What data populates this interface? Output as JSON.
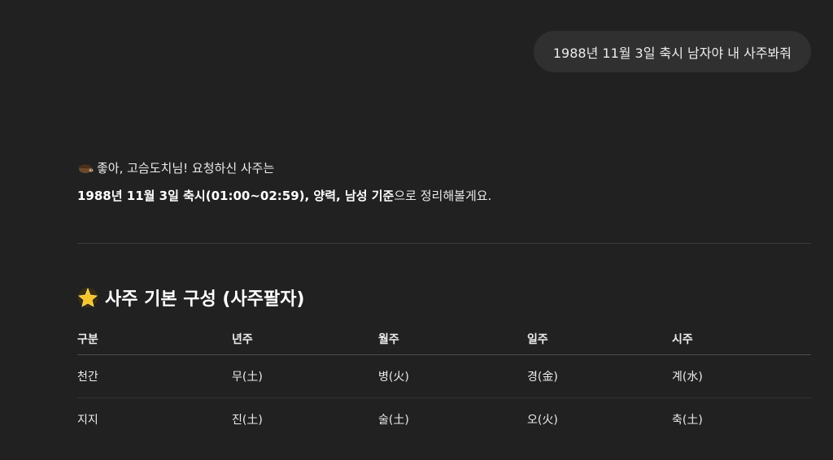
{
  "user_message": "1988년 11월 3일 축시 남자야 내 사주봐줘",
  "assistant": {
    "intro_emoji": "hedgehog-icon",
    "line1": "좋아, 고슴도치님! 요청하신 사주는",
    "line2_bold": "1988년 11월 3일 축시(01:00~02:59), 양력, 남성 기준",
    "line2_rest": "으로 정리해볼게요."
  },
  "section": {
    "emoji": "glowing-star-icon",
    "title": "사주 기본 구성 (사주팔자)"
  },
  "table": {
    "headers": [
      "구분",
      "년주",
      "월주",
      "일주",
      "시주"
    ],
    "rows": [
      [
        "천간",
        "무(土)",
        "병(火)",
        "경(金)",
        "계(水)"
      ],
      [
        "지지",
        "진(土)",
        "술(土)",
        "오(火)",
        "축(土)"
      ]
    ]
  },
  "colors": {
    "background": "#212121",
    "bubble": "#303030",
    "text": "#ececec"
  }
}
